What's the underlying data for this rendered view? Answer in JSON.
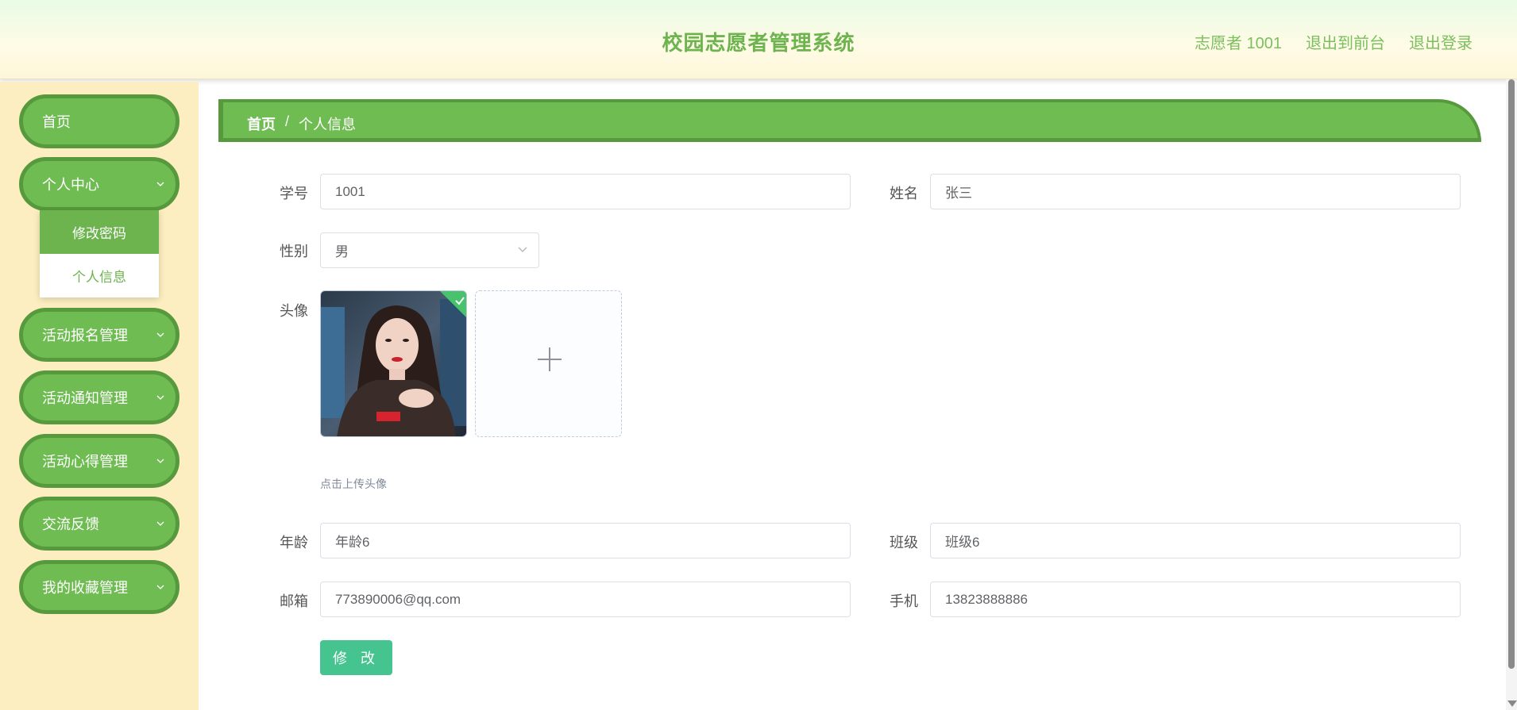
{
  "header": {
    "title": "校园志愿者管理系统",
    "user": "志愿者 1001",
    "to_front": "退出到前台",
    "logout": "退出登录"
  },
  "sidebar": {
    "items": [
      {
        "label": "首页"
      },
      {
        "label": "个人中心"
      },
      {
        "label": "活动报名管理"
      },
      {
        "label": "活动通知管理"
      },
      {
        "label": "活动心得管理"
      },
      {
        "label": "交流反馈"
      },
      {
        "label": "我的收藏管理"
      }
    ],
    "submenu": [
      {
        "label": "修改密码",
        "active": true
      },
      {
        "label": "个人信息",
        "active": false
      }
    ]
  },
  "breadcrumb": {
    "home": "首页",
    "separator": "/",
    "current": "个人信息"
  },
  "form": {
    "student_id": {
      "label": "学号",
      "value": "1001"
    },
    "name": {
      "label": "姓名",
      "value": "张三"
    },
    "gender": {
      "label": "性别",
      "value": "男"
    },
    "avatar": {
      "label": "头像",
      "hint": "点击上传头像"
    },
    "age": {
      "label": "年龄",
      "value": "年龄6"
    },
    "class": {
      "label": "班级",
      "value": "班级6"
    },
    "email": {
      "label": "邮箱",
      "value": "773890006@qq.com"
    },
    "phone": {
      "label": "手机",
      "value": "13823888886"
    },
    "submit_label": "修 改"
  },
  "colors": {
    "accent_green": "#6fbc52",
    "dark_green": "#579a3d",
    "button_teal": "#46c490",
    "sidebar_bg": "#fdeec1"
  },
  "icons": {
    "chevron": "chevron-down-icon",
    "upload": "plus-icon",
    "success": "check-icon"
  }
}
